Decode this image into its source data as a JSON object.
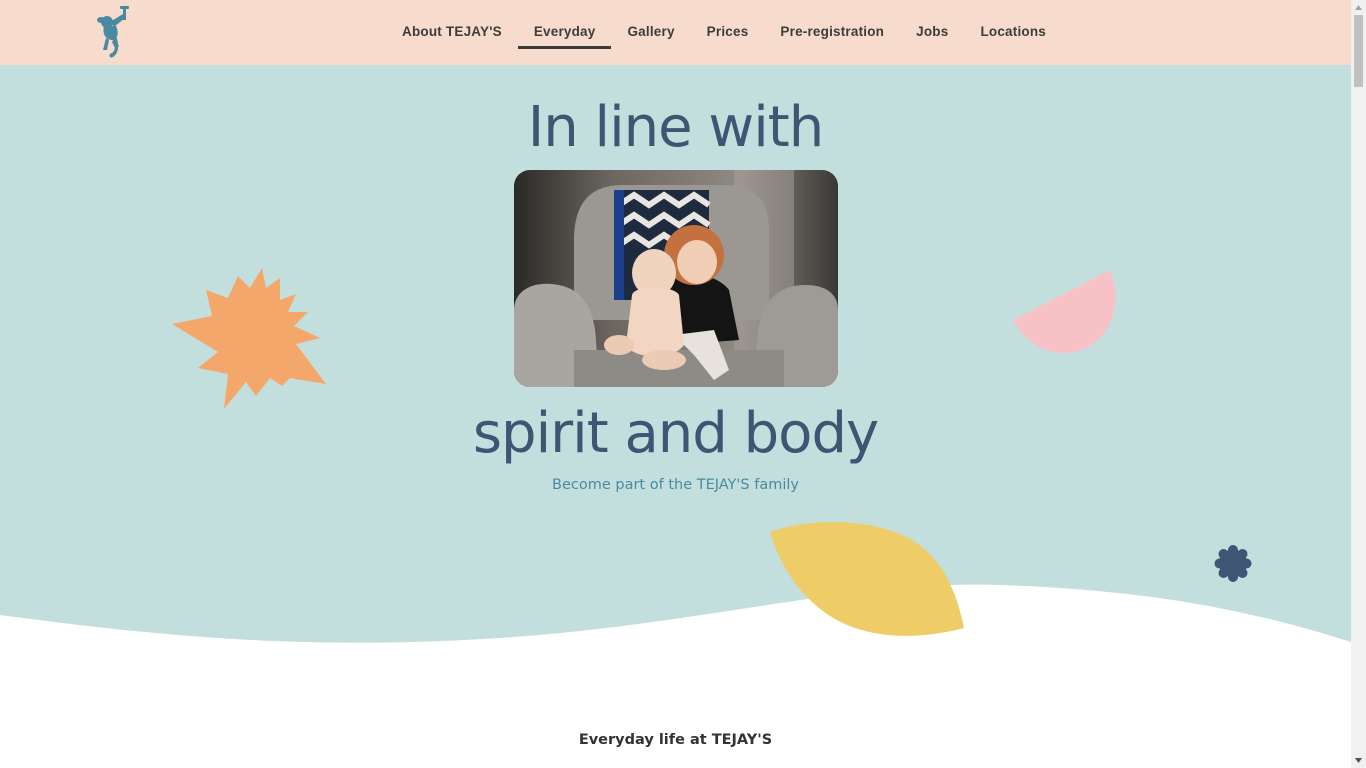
{
  "header": {
    "logo_icon": "monkey-logo-icon",
    "nav": [
      {
        "label": "About TEJAY'S",
        "active": false
      },
      {
        "label": "Everyday",
        "active": true
      },
      {
        "label": "Gallery",
        "active": false
      },
      {
        "label": "Prices",
        "active": false
      },
      {
        "label": "Pre-registration",
        "active": false
      },
      {
        "label": "Jobs",
        "active": false
      },
      {
        "label": "Locations",
        "active": false
      }
    ]
  },
  "hero": {
    "headline_top": "In line with",
    "headline_bottom": "spirit and body",
    "tagline": "Become part of the TEJAY'S family",
    "photo_icon": "children-photo",
    "background_color": "#c3dfdd",
    "shapes": {
      "starburst_color": "#f4a76a",
      "half_circle_color": "#f8c1c5",
      "leaf_color": "#eecc67",
      "flower_color": "#3e5573"
    }
  },
  "section": {
    "title": "Everyday life at TEJAY'S"
  },
  "colors": {
    "header_bg": "#f7dccd",
    "heading": "#3e5573",
    "tagline": "#4a8aa0"
  }
}
